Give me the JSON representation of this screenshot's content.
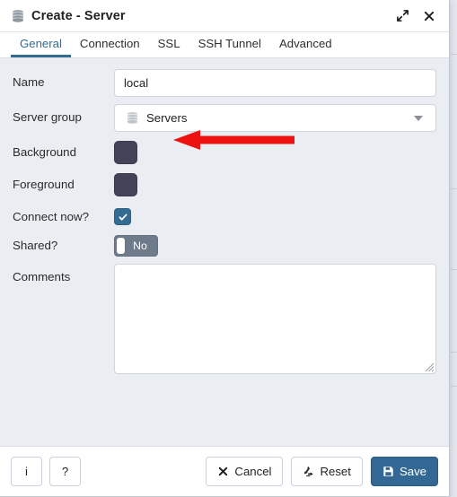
{
  "window": {
    "title": "Create - Server",
    "title_icon": "database-stack-icon",
    "expand_icon": "expand-diagonal-icon",
    "close_icon": "close-x-icon"
  },
  "tabs": [
    {
      "label": "General",
      "active": true
    },
    {
      "label": "Connection",
      "active": false
    },
    {
      "label": "SSL",
      "active": false
    },
    {
      "label": "SSH Tunnel",
      "active": false
    },
    {
      "label": "Advanced",
      "active": false
    }
  ],
  "form": {
    "name": {
      "label": "Name",
      "value": "local",
      "placeholder": ""
    },
    "server_group": {
      "label": "Server group",
      "value": "Servers",
      "icon": "database-stack-icon",
      "options": [
        "Servers"
      ]
    },
    "background": {
      "label": "Background",
      "color": "#434357"
    },
    "foreground": {
      "label": "Foreground",
      "color": "#434357"
    },
    "connect_now": {
      "label": "Connect now?",
      "checked": true,
      "accent": "#326c93"
    },
    "shared": {
      "label": "Shared?",
      "state_label": "No",
      "on": false,
      "track_color": "#6e7b8b"
    },
    "comments": {
      "label": "Comments",
      "value": "",
      "placeholder": ""
    }
  },
  "annotation": {
    "type": "arrow",
    "direction": "left",
    "color": "#ee1111",
    "points_at": "name-input"
  },
  "footer": {
    "info_label": "i",
    "help_label": "?",
    "cancel_label": "Cancel",
    "reset_label": "Reset",
    "save_label": "Save",
    "save_color": "#346894"
  }
}
